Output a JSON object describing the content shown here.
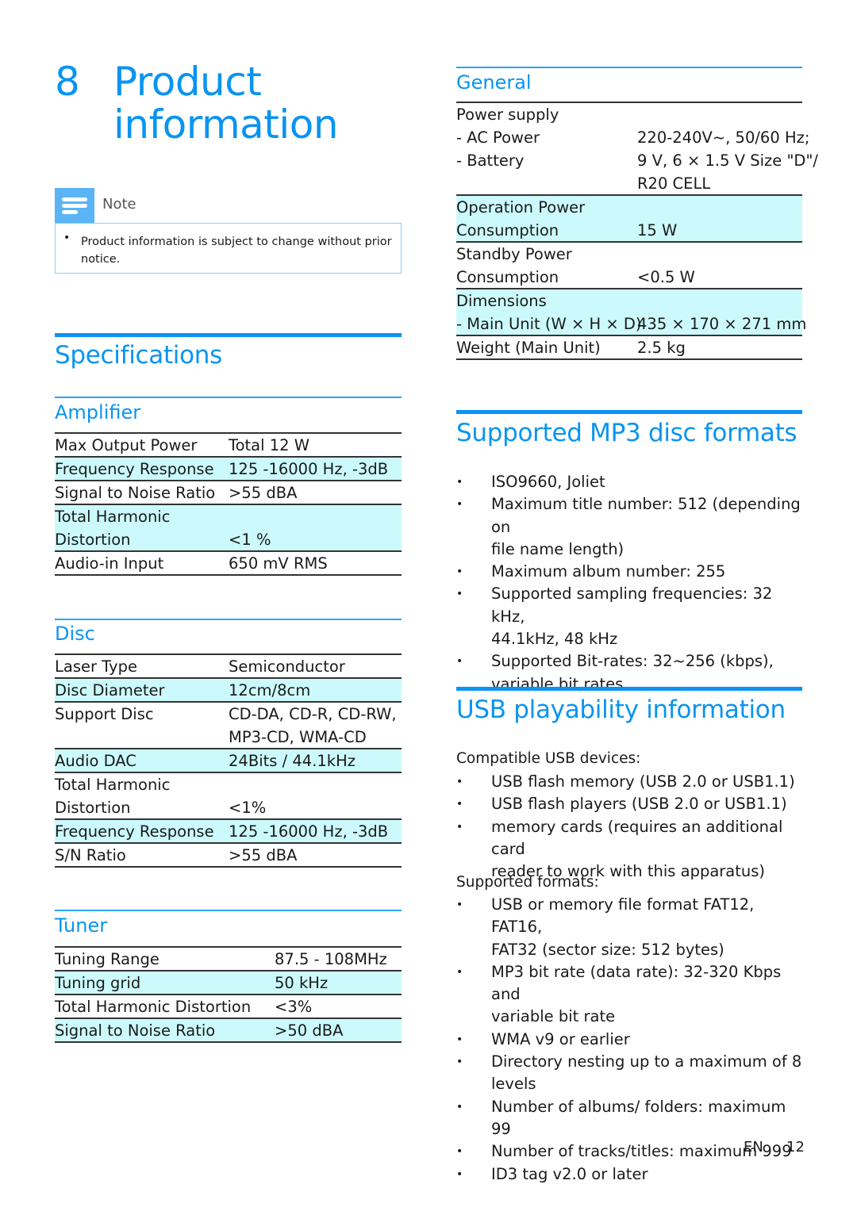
{
  "chapter": {
    "number": "8",
    "title_line1": "Product",
    "title_line2": "information"
  },
  "note": {
    "icon": "note-icon",
    "label": "Note",
    "bullet": "•",
    "text": "Product information is subject to change without prior notice."
  },
  "specifications": {
    "title": "Specifications",
    "amplifier": {
      "title": "Amplifier",
      "rows": [
        {
          "key": [
            "Max Output Power"
          ],
          "value": [
            "Total 12 W"
          ],
          "highlight": false
        },
        {
          "key": [
            "Frequency Response"
          ],
          "value": [
            "125 -16000 Hz, -3dB"
          ],
          "highlight": true
        },
        {
          "key": [
            "Signal to Noise Ratio"
          ],
          "value": [
            ">55 dBA"
          ],
          "highlight": false
        },
        {
          "key": [
            "Total Harmonic",
            "Distortion"
          ],
          "value": [
            "",
            "<1 %"
          ],
          "highlight": true
        },
        {
          "key": [
            "Audio-in Input"
          ],
          "value": [
            "650 mV RMS"
          ],
          "highlight": false
        }
      ]
    },
    "disc": {
      "title": "Disc",
      "rows": [
        {
          "key": [
            "Laser Type"
          ],
          "value": [
            "Semiconductor"
          ],
          "highlight": false
        },
        {
          "key": [
            "Disc Diameter"
          ],
          "value": [
            "12cm/8cm"
          ],
          "highlight": true
        },
        {
          "key": [
            "Support Disc"
          ],
          "value": [
            "CD-DA, CD-R, CD-RW,",
            "MP3-CD, WMA-CD"
          ],
          "highlight": false
        },
        {
          "key": [
            "Audio DAC"
          ],
          "value": [
            "24Bits / 44.1kHz"
          ],
          "highlight": true
        },
        {
          "key": [
            "Total Harmonic",
            "Distortion"
          ],
          "value": [
            "",
            "<1%"
          ],
          "highlight": false
        },
        {
          "key": [
            "Frequency Response"
          ],
          "value": [
            "125 -16000 Hz, -3dB"
          ],
          "highlight": true
        },
        {
          "key": [
            "S/N Ratio"
          ],
          "value": [
            ">55 dBA"
          ],
          "highlight": false
        }
      ]
    },
    "tuner": {
      "title": "Tuner",
      "rows": [
        {
          "key": [
            "Tuning Range"
          ],
          "value": [
            "87.5 - 108MHz"
          ],
          "highlight": false
        },
        {
          "key": [
            "Tuning grid"
          ],
          "value": [
            "50 kHz"
          ],
          "highlight": true
        },
        {
          "key": [
            "Total Harmonic Distortion"
          ],
          "value": [
            "<3%"
          ],
          "highlight": false
        },
        {
          "key": [
            "Signal to Noise Ratio"
          ],
          "value": [
            ">50 dBA"
          ],
          "highlight": true
        }
      ]
    },
    "general": {
      "title": "General",
      "rows": [
        {
          "key": [
            "Power supply",
            " - AC Power",
            " - Battery",
            ""
          ],
          "value": [
            "",
            "220-240V~, 50/60 Hz;",
            "9 V, 6 × 1.5 V Size \"D\"/",
            "R20 CELL"
          ],
          "highlight": false
        },
        {
          "key": [
            "Operation Power",
            "Consumption"
          ],
          "value": [
            "",
            "15 W"
          ],
          "highlight": true
        },
        {
          "key": [
            "Standby Power",
            "Consumption"
          ],
          "value": [
            "",
            "<0.5 W"
          ],
          "highlight": false
        },
        {
          "key": [
            "Dimensions",
            "- Main Unit (W × H × D)"
          ],
          "value": [
            "",
            "435 × 170 × 271 mm"
          ],
          "highlight": true
        },
        {
          "key": [
            "Weight (Main Unit)"
          ],
          "value": [
            "2.5 kg"
          ],
          "highlight": false
        }
      ]
    }
  },
  "mp3": {
    "title": "Supported MP3 disc formats",
    "items": [
      [
        "ISO9660, Joliet"
      ],
      [
        "Maximum title number: 512 (depending on",
        "file name length)"
      ],
      [
        "Maximum album number: 255"
      ],
      [
        "Supported sampling frequencies: 32 kHz,",
        "44.1kHz, 48 kHz"
      ],
      [
        "Supported Bit-rates: 32~256 (kbps),",
        "variable bit rates"
      ]
    ]
  },
  "usb": {
    "title": "USB playability information",
    "devices_label": "Compatible USB devices:",
    "devices": [
      [
        "USB flash memory (USB 2.0 or USB1.1)"
      ],
      [
        "USB flash players (USB 2.0 or USB1.1)"
      ],
      [
        "memory cards (requires an additional card",
        "reader to work with this apparatus)"
      ]
    ],
    "formats_label": "Supported formats:",
    "formats": [
      [
        "USB or memory file format FAT12, FAT16,",
        "FAT32 (sector size: 512 bytes)"
      ],
      [
        "MP3 bit rate (data rate): 32-320 Kbps and",
        "variable bit rate"
      ],
      [
        "WMA v9 or earlier"
      ],
      [
        "Directory nesting up to a maximum of 8",
        "levels"
      ],
      [
        "Number of albums/ folders: maximum 99"
      ],
      [
        "Number of tracks/titles: maximum 999"
      ],
      [
        "ID3 tag v2.0 or later"
      ]
    ]
  },
  "footer": {
    "lang": "EN",
    "page": "12"
  },
  "colors": {
    "accent": "#0a94f0",
    "highlight_row": "#ccfafc",
    "note_icon": "#5ab4f5"
  }
}
